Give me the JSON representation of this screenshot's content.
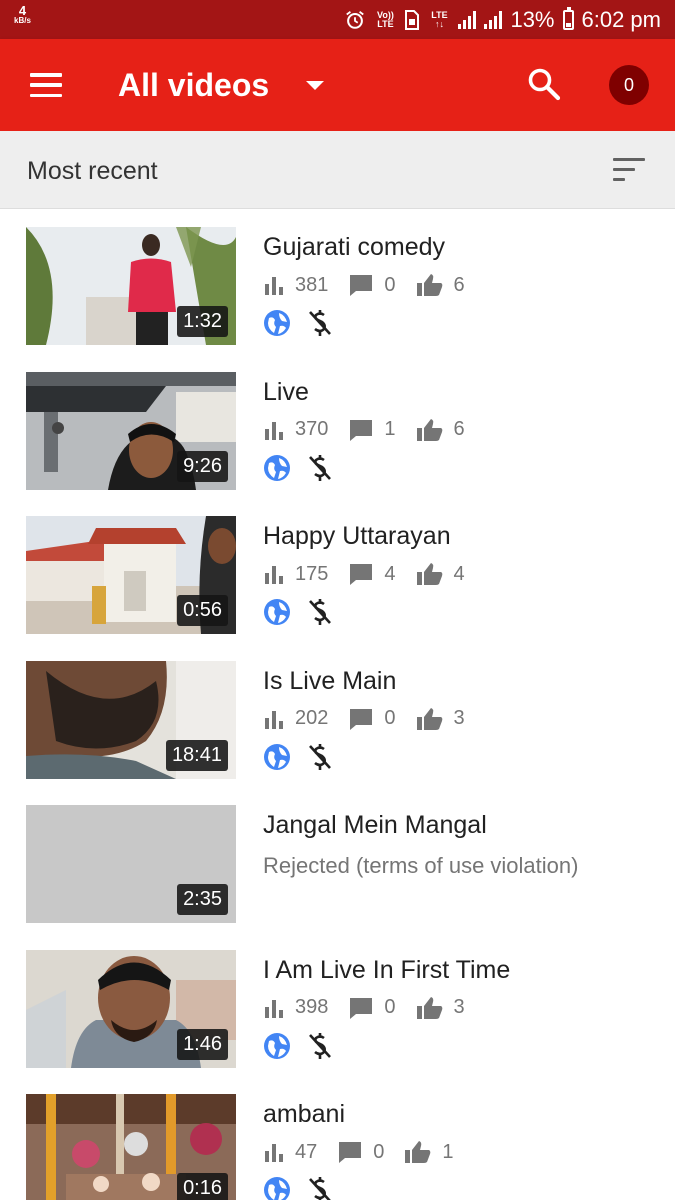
{
  "status_bar": {
    "speed_value": "4",
    "speed_unit": "kB/s",
    "volte": "Vo)) LTE",
    "lte": "LTE",
    "battery": "13%",
    "time": "6:02 pm"
  },
  "app_bar": {
    "title": "All videos",
    "notification_count": "0"
  },
  "sort_bar": {
    "label": "Most recent"
  },
  "colors": {
    "app_bar": "#e62117",
    "status_bar": "#a31515",
    "globe": "#4285f4"
  },
  "videos": [
    {
      "title": "Gujarati comedy",
      "duration": "1:32",
      "views": "381",
      "comments": "0",
      "likes": "6"
    },
    {
      "title": "Live",
      "duration": "9:26",
      "views": "370",
      "comments": "1",
      "likes": "6"
    },
    {
      "title": "Happy Uttarayan",
      "duration": "0:56",
      "views": "175",
      "comments": "4",
      "likes": "4"
    },
    {
      "title": "Is Live Main",
      "duration": "18:41",
      "views": "202",
      "comments": "0",
      "likes": "3"
    },
    {
      "title": "Jangal Mein Mangal",
      "duration": "2:35",
      "status": "Rejected (terms of use violation)"
    },
    {
      "title": "I Am Live In First Time",
      "duration": "1:46",
      "views": "398",
      "comments": "0",
      "likes": "3"
    },
    {
      "title": "ambani",
      "duration": "0:16",
      "views": "47",
      "comments": "0",
      "likes": "1"
    }
  ]
}
